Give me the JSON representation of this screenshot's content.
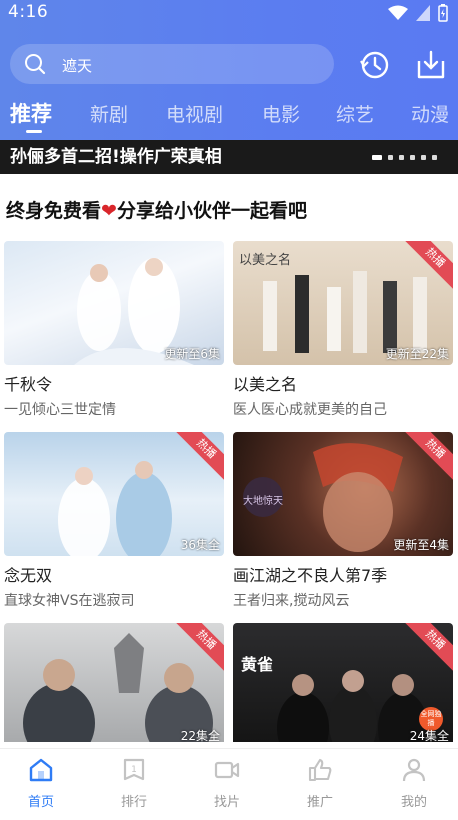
{
  "status_bar": {
    "time": "4:16"
  },
  "search": {
    "placeholder": "遮天"
  },
  "tabs": [
    {
      "label": "推荐",
      "active": true
    },
    {
      "label": "新剧"
    },
    {
      "label": "电视剧"
    },
    {
      "label": "电影"
    },
    {
      "label": "综艺"
    },
    {
      "label": "动漫"
    }
  ],
  "banner": {
    "text": "孙俪多首二招!操作广荣真相"
  },
  "section": {
    "title_before": "终身免费看",
    "heart": "❤",
    "title_after": "分享给小伙伴一起看吧"
  },
  "cards": [
    {
      "name": "千秋令",
      "desc": "一见倾心三世定情",
      "episodes": "更新至6集",
      "hot": false,
      "thumb_colors": [
        "#d9e6f3",
        "#f3f6fb"
      ]
    },
    {
      "name": "以美之名",
      "desc": "医人医心成就更美的自己",
      "episodes": "更新至22集",
      "hot": true,
      "hot_label": "热播",
      "poster_text": "以美之名",
      "thumb_colors": [
        "#e6d8c6",
        "#cbb79f"
      ]
    },
    {
      "name": "念无双",
      "desc": "直球女神VS在逃寂司",
      "episodes": "36集全",
      "hot": true,
      "hot_label": "热播",
      "thumb_colors": [
        "#c7ddef",
        "#e9f2f9"
      ]
    },
    {
      "name": "画江湖之不良人第7季",
      "desc": "王者归来,搅动风云",
      "episodes": "更新至4集",
      "hot": true,
      "hot_label": "热播",
      "poster_text": "大地惊天",
      "thumb_colors": [
        "#3c2620",
        "#8a4a34"
      ]
    },
    {
      "name": "",
      "desc": "",
      "episodes": "22集全",
      "hot": true,
      "hot_label": "热播",
      "thumb_colors": [
        "#a7a9ab",
        "#d4d5d6"
      ]
    },
    {
      "name": "",
      "desc": "",
      "episodes": "24集全",
      "hot": true,
      "hot_label": "热播",
      "poster_text": "黄雀",
      "badge": "全网独播",
      "thumb_colors": [
        "#1f1f21",
        "#4a4a4c"
      ]
    }
  ],
  "bottom_nav": [
    {
      "label": "首页",
      "icon": "home-icon",
      "active": true
    },
    {
      "label": "排行",
      "icon": "rank-icon"
    },
    {
      "label": "找片",
      "icon": "video-icon"
    },
    {
      "label": "推广",
      "icon": "thumb-up-icon"
    },
    {
      "label": "我的",
      "icon": "user-icon"
    }
  ],
  "colors": {
    "accent": "#2f7cf5",
    "header": "#5b7df0",
    "ribbon": "#e24b55"
  }
}
